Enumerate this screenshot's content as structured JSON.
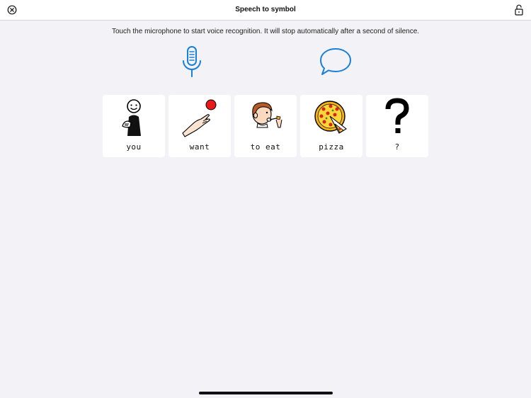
{
  "nav": {
    "title": "Speech to symbol",
    "close_icon": "close-circle-icon",
    "lock_icon": "lock-icon"
  },
  "instruction": "Touch the microphone to start voice recognition. It will stop automatically after a second of silence.",
  "controls": {
    "mic_icon": "microphone-icon",
    "speak_icon": "speech-bubble-icon",
    "accent_color": "#1a7fd6"
  },
  "symbols": [
    {
      "label": "you",
      "icon": "person-pointing-icon"
    },
    {
      "label": "want",
      "icon": "hand-reaching-icon"
    },
    {
      "label": "to  eat",
      "icon": "boy-eating-icon"
    },
    {
      "label": "pizza",
      "icon": "pizza-icon"
    },
    {
      "label": "?",
      "icon": "question-mark-icon"
    }
  ]
}
